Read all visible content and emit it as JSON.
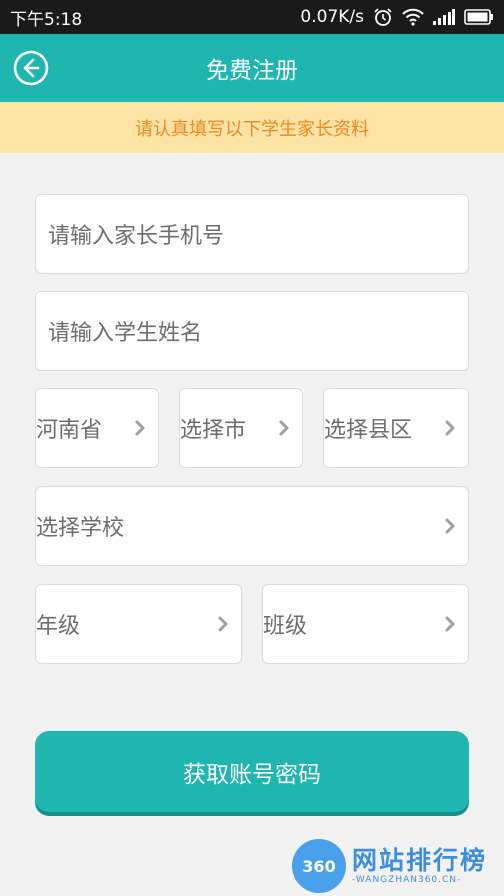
{
  "status_bar": {
    "time": "下午5:18",
    "network_speed": "0.07K/s",
    "icons": [
      "alarm-icon",
      "wifi-icon",
      "signal-icon",
      "battery-icon"
    ]
  },
  "nav": {
    "title": "免费注册",
    "back_icon": "back-arrow-icon"
  },
  "notice": {
    "text": "请认真填写以下学生家长资料"
  },
  "form": {
    "phone_placeholder": "请输入家长手机号",
    "student_name_placeholder": "请输入学生姓名",
    "province": "河南省",
    "city": "选择市",
    "county": "选择县区",
    "school": "选择学校",
    "grade": "年级",
    "class": "班级"
  },
  "submit_label": "获取账号密码",
  "watermark": {
    "badge": "360",
    "title": "网站排行榜",
    "url": "-WANGZHAN360.CN-"
  },
  "colors": {
    "accent": "#20b6b0",
    "notice_bg": "#fde3a6",
    "notice_text": "#f08a1e",
    "status_bar": "#1a1a1a"
  }
}
